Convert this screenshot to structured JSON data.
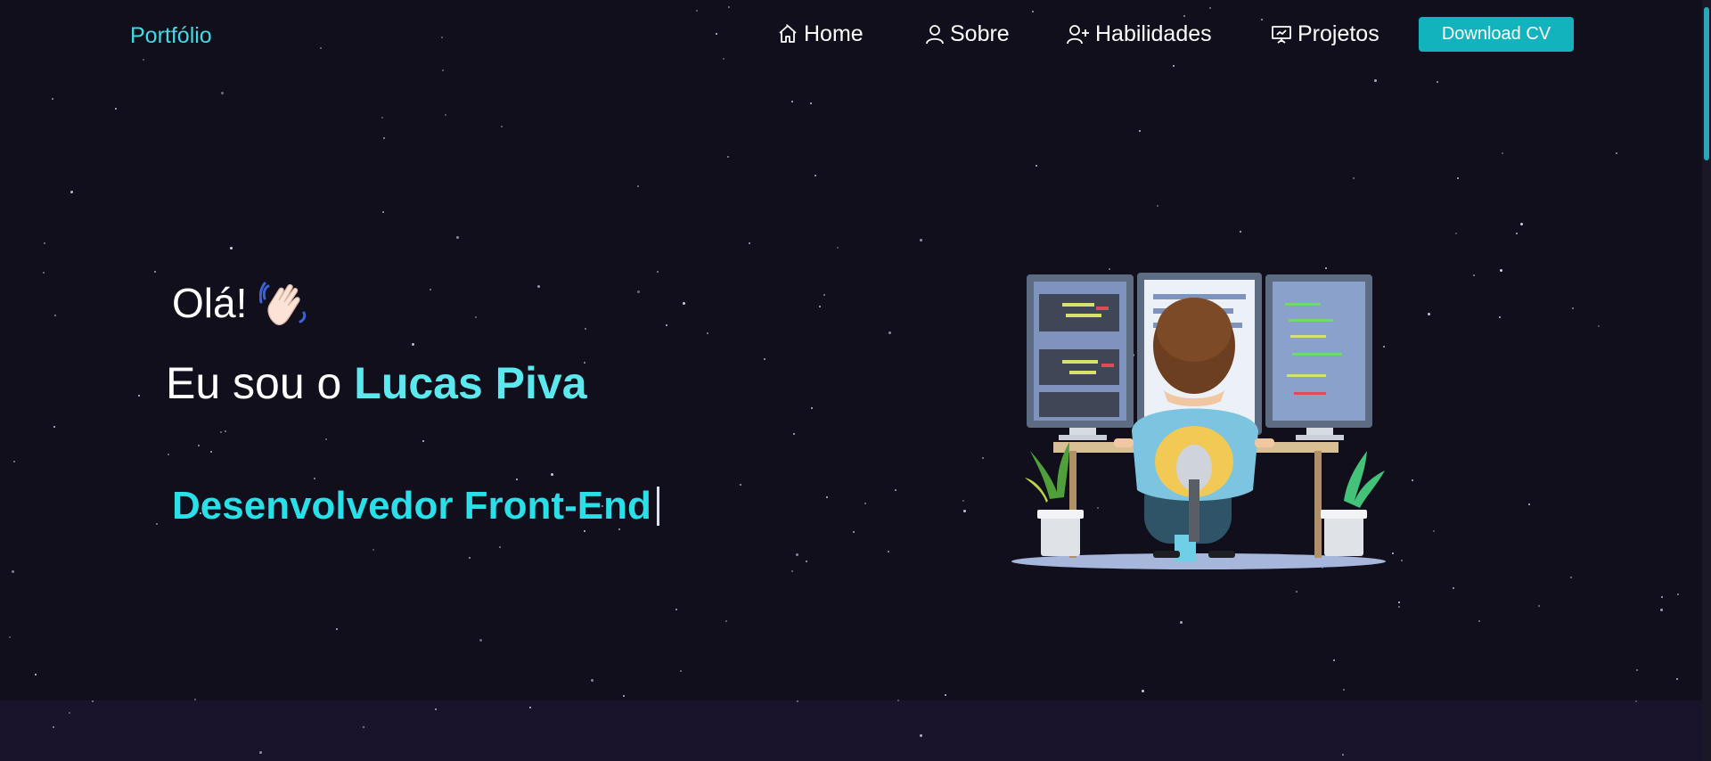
{
  "brand": "Portfólio",
  "nav": {
    "home": "Home",
    "sobre": "Sobre",
    "habilidades": "Habilidades",
    "projetos": "Projetos",
    "download": "Download CV"
  },
  "hero": {
    "greeting": "Olá!",
    "intro_prefix": "Eu sou o",
    "name": "Lucas Piva",
    "role": "Desenvolvedor Front-End"
  },
  "icons": {
    "home": "home-icon",
    "sobre": "user-icon",
    "habilidades": "user-plus-icon",
    "projetos": "presentation-icon",
    "wave": "waving-hand-icon"
  },
  "colors": {
    "background": "#110f1b",
    "accent": "#41dbe6",
    "button": "#12b3bd",
    "name": "#5ce9ee",
    "role": "#2adfe8"
  }
}
